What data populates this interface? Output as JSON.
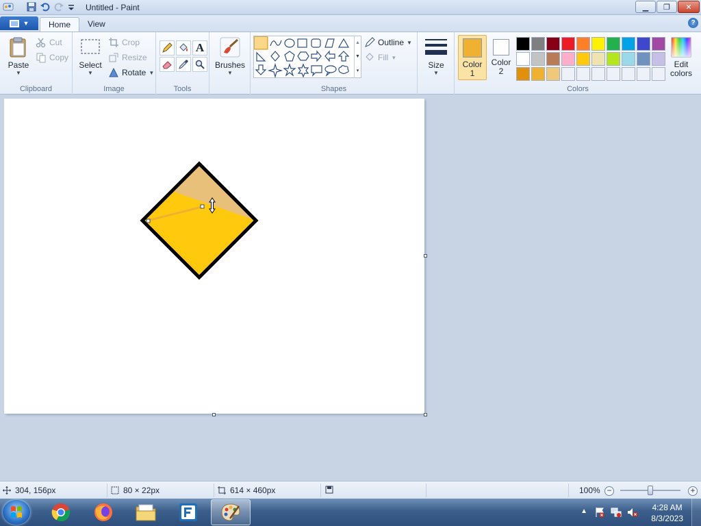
{
  "window": {
    "title": "Untitled - Paint",
    "minimize": "▁",
    "restore": "❐",
    "close": "✕"
  },
  "tabs": {
    "home": "Home",
    "view": "View",
    "help": "?"
  },
  "clipboard": {
    "paste": "Paste",
    "cut": "Cut",
    "copy": "Copy",
    "group_label": "Clipboard"
  },
  "image": {
    "select": "Select",
    "crop": "Crop",
    "resize": "Resize",
    "rotate": "Rotate",
    "group_label": "Image"
  },
  "tools": {
    "group_label": "Tools",
    "text_tool_glyph": "A"
  },
  "brushes": {
    "label": "Brushes"
  },
  "shapes": {
    "outline": "Outline",
    "fill": "Fill",
    "group_label": "Shapes",
    "selected": "line",
    "items": [
      "line",
      "curve",
      "oval",
      "rectangle",
      "rounded-rectangle",
      "polygon",
      "triangle",
      "right-triangle",
      "diamond",
      "pentagon",
      "hexagon",
      "right-arrow",
      "left-arrow",
      "up-arrow",
      "down-arrow",
      "four-point-star",
      "five-point-star",
      "six-point-star",
      "rounded-callout",
      "oval-callout",
      "cloud-callout"
    ]
  },
  "size": {
    "label": "Size"
  },
  "colors": {
    "color1_label": "Color",
    "color1_num": "1",
    "color2_label": "Color",
    "color2_num": "2",
    "edit_label": "Edit",
    "edit_label2": "colors",
    "group_label": "Colors",
    "color1": "#f0b030",
    "color2": "#ffffff",
    "palette": [
      "#000000",
      "#7f7f7f",
      "#880015",
      "#ed1c24",
      "#ff7f27",
      "#fff200",
      "#22b14c",
      "#00a2e8",
      "#3f48cc",
      "#a349a4",
      "#ffffff",
      "#c3c3c3",
      "#b97a57",
      "#ffaec9",
      "#ffc90e",
      "#efe4b0",
      "#b5e61d",
      "#99d9ea",
      "#7092be",
      "#c8bfe7",
      "#e0900c",
      "#f0b030",
      "#f0c87a",
      "#eef2f8",
      "#eef2f8",
      "#eef2f8",
      "#eef2f8",
      "#eef2f8",
      "#eef2f8",
      "#eef2f8"
    ]
  },
  "drawing": {
    "diamond_fill": "#ffc90e",
    "diamond_top_fill": "#e9c07a",
    "diamond_stroke": "#000000",
    "line_color": "#f0b030"
  },
  "status": {
    "cursor_pos": "304, 156px",
    "selection_size": "80 × 22px",
    "canvas_size": "614 × 460px",
    "zoom": "100%",
    "zoom_out": "−",
    "zoom_in": "+"
  },
  "taskbar": {
    "time": "4:28 AM",
    "date": "8/3/2023"
  }
}
